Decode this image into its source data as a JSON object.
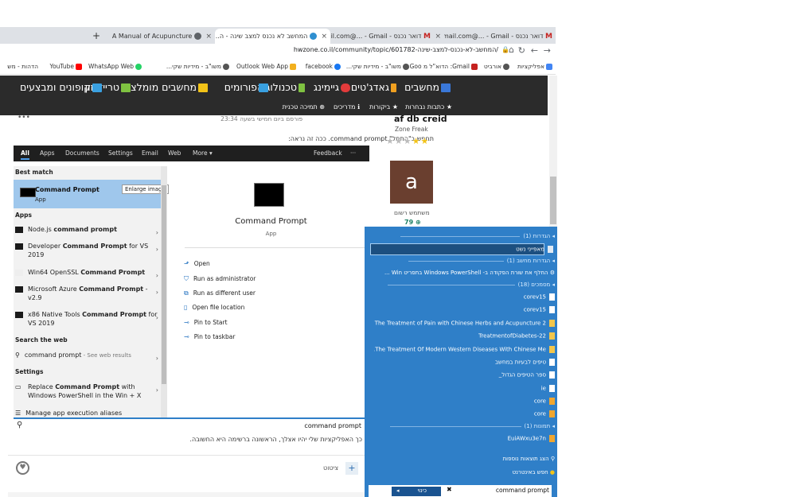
{
  "browser": {
    "tabs": [
      {
        "title": "דואר נכנס - Gmail ‏- ...@gmail.com",
        "icon": "gmail-icon"
      },
      {
        "title": "דואר נכנס - Gmail ‏- ...@gmail.com",
        "icon": "gmail-icon"
      },
      {
        "title": "המחשב לא נכנס למצב שינה - ה...",
        "icon": "hwzone-icon"
      },
      {
        "title": "A Manual of Acupuncture",
        "icon": "globe-icon"
      }
    ],
    "new_tab": "+",
    "url": "hwzone.co.il/community/topic/601782-המחשב-לא-נכנס-למצב-שינה/",
    "bookmarks": [
      "אפליקציות",
      "אורביט",
      "Gmail: הדוא\"ל מ Goo...",
      "משו\"ב - מידיות שקי...",
      "facebook",
      "Outlook Web App",
      "משו\"ב - מידיות שקי...",
      "WhatsApp Web",
      "YouTube",
      "הדהות - מש"
    ]
  },
  "site": {
    "nav": [
      "מחשבים",
      "גאדג'טים",
      "גיימינג",
      "טכנולוגיה",
      "פורומים",
      "מחשבים מומלצים",
      "טרייד-זון",
      "קופונים ומבצעים"
    ],
    "subnav": [
      "כתבות נבחרות",
      "ביקורות",
      "מדריכים",
      "תמיכה טכנית"
    ],
    "post_meta": "פורסם ביום חמישי בשעה 23:34",
    "post_text": "תחפש ב\"התחל\" command prompt. ככה זה נראה:",
    "more_dots": "•••",
    "user": {
      "name": "af db creid",
      "rank": "Zone Freak",
      "avatar_letter": "a",
      "new_user": "משתמש רשום",
      "count": "79",
      "stars": "★★★★★"
    },
    "below_text": "כך האפליקציות שלי יהיו אצלך, הראשונה ברשימה היא החשובה.",
    "quote_label": "ציטוט",
    "plus": "+"
  },
  "winsearch": {
    "tabs": [
      "All",
      "Apps",
      "Documents",
      "Settings",
      "Email",
      "Web",
      "More ▾"
    ],
    "feedback": "Feedback",
    "more": "···",
    "best_match_label": "Best match",
    "best_match": {
      "name": "Command Prompt",
      "type": "App"
    },
    "enlarge": "Enlarge image",
    "apps_label": "Apps",
    "apps": [
      {
        "pre": "Node.js ",
        "bold": "command prompt",
        "post": ""
      },
      {
        "pre": "Developer ",
        "bold": "Command Prompt",
        "post": " for VS 2019"
      },
      {
        "pre": "Win64 OpenSSL ",
        "bold": "Command Prompt",
        "post": ""
      },
      {
        "pre": "Microsoft Azure ",
        "bold": "Command Prompt",
        "post": " - v2.9"
      },
      {
        "pre": "x86 Native Tools ",
        "bold": "Command Prompt",
        "post": " for VS 2019"
      }
    ],
    "web_label": "Search the web",
    "web_item": {
      "text": "command prompt",
      "suffix": " - See web results"
    },
    "settings_label": "Settings",
    "settings_item": {
      "pre": "Replace ",
      "bold": "Command Prompt",
      "post": " with Windows PowerShell in the Win + X"
    },
    "manage_item": "Manage app execution aliases",
    "detail_title": "Command Prompt",
    "detail_sub": "App",
    "actions": [
      "Open",
      "Run as administrator",
      "Run as different user",
      "Open file location",
      "Pin to Start",
      "Pin to taskbar"
    ],
    "query": "command prompt"
  },
  "everything": {
    "sections": [
      {
        "head": "הגדרות (1)",
        "items": [
          "מאפייני נשט"
        ]
      },
      {
        "head": "הגדרות מחשב (1)",
        "items": [
          "החלף את שורת הפקודה ב- Windows PowerShell בתפריט Win ..."
        ]
      },
      {
        "head": "מסמכים (18)",
        "items": [
          "corev15",
          "corev15",
          "The Treatment of Pain with Chinese Herbs and Acupuncture 2...",
          "TreatmentofDiabetes-22",
          "The Treatment Of Modern Western Diseases With Chinese Me...",
          "טיפים לבעיות במחשב",
          "ספר הטיפים הגדול_",
          "ie",
          "core",
          "core"
        ]
      },
      {
        "head": "תמונות (1)",
        "items": [
          "EuiAWxu3e7n"
        ]
      }
    ],
    "more_results": "הצג תוצאות נוספות",
    "search_internet": "חפש באינטרנט",
    "prev": "כינוי",
    "query": "command prompt"
  }
}
